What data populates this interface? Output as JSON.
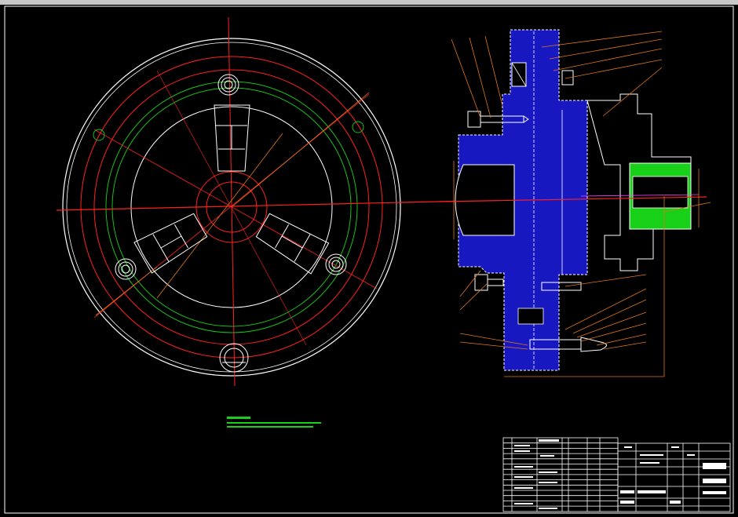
{
  "window": {
    "title": ""
  },
  "colors": {
    "background": "#000000",
    "outline": "#ffffff",
    "centerline": "#ff2020",
    "circle_green": "#18c018",
    "leader": "#e07818",
    "hatch_blue": "#1818c0",
    "hatch_green": "#18d018",
    "title_block": "#ffffff",
    "note_green": "#18d018"
  },
  "icons": {
    "bolt_symbol": "bolt-icon",
    "hole_symbol": "hole-icon"
  },
  "title_block": {
    "rows": 14,
    "cols": 6
  }
}
